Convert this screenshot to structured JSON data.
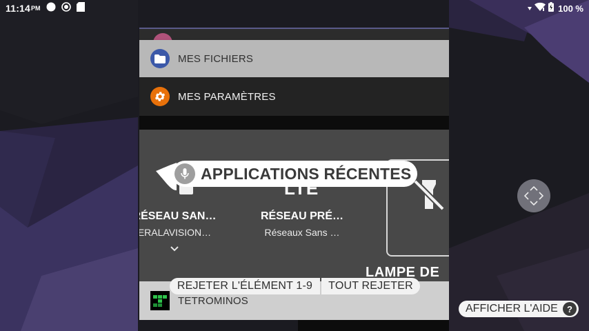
{
  "status_bar": {
    "time": "11:14",
    "ampm": "PM",
    "battery": "100 %",
    "icons": [
      "notification-dot-icon",
      "sync-icon",
      "sd-card-icon",
      "vibrate-icon",
      "wifi-icon",
      "battery-icon"
    ]
  },
  "recents": {
    "back_card_icon": "app-icon-pink",
    "files": {
      "title": "MES FICHIERS",
      "icon": "folder-icon",
      "icon_color": "#3b58a8"
    },
    "settings": {
      "title": "MES PARAMÈTRES",
      "icon": "gear-icon",
      "icon_color": "#e8710a"
    },
    "quick_settings": {
      "tile1": {
        "title": "RÉSEAU SAN…",
        "subtitle": "ERALAVISION…"
      },
      "tile2": {
        "title": "RÉSEAU PRÉ…",
        "subtitle": "Réseaux Sans …"
      },
      "lte": "LTE",
      "lamp": "LAMPE DE"
    },
    "tetrominos": {
      "title": "TETROMINOS",
      "icon": "tetrominos-icon"
    }
  },
  "overlay": {
    "recents_label": "APPLICATIONS RÉCENTES",
    "dismiss_one": "REJETER L'ÉLÉMENT 1-9",
    "dismiss_all": "TOUT REJETER",
    "help": "AFFICHER L'AIDE",
    "help_glyph": "?"
  },
  "colors": {
    "wallpaper_dark": "#191920",
    "wallpaper_purple": "#3a2f5a",
    "files_card": "#b8b8b8",
    "settings_card": "#232323",
    "qs_card": "#484848"
  }
}
